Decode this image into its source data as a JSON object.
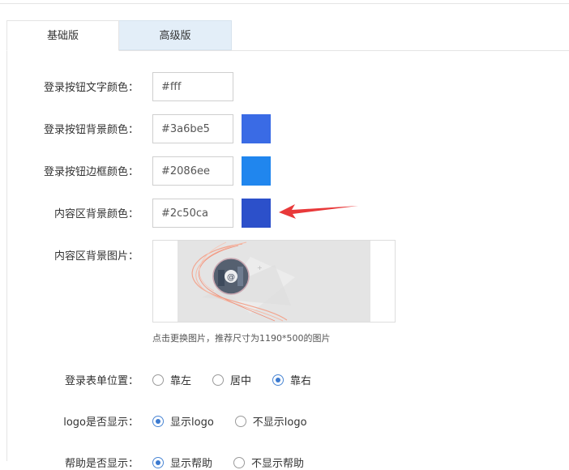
{
  "tabs": [
    {
      "label": "基础版",
      "active": true
    },
    {
      "label": "高级版",
      "active": false
    }
  ],
  "fields": {
    "btn_text_color": {
      "label": "登录按钮文字颜色：",
      "value": "#fff"
    },
    "btn_bg_color": {
      "label": "登录按钮背景颜色：",
      "value": "#3a6be5",
      "swatch": "#3a6be5"
    },
    "btn_border_color": {
      "label": "登录按钮边框颜色：",
      "value": "#2086ee",
      "swatch": "#2086ee"
    },
    "content_bg_color": {
      "label": "内容区背景颜色：",
      "value": "#2c50ca",
      "swatch": "#2c50ca"
    },
    "content_bg_image": {
      "label": "内容区背景图片：",
      "hint": "点击更换图片，推荐尺寸为1190*500的图片"
    }
  },
  "form_position": {
    "label": "登录表单位置：",
    "options": [
      {
        "label": "靠左",
        "checked": false
      },
      {
        "label": "居中",
        "checked": false
      },
      {
        "label": "靠右",
        "checked": true
      }
    ]
  },
  "logo_display": {
    "label": "logo是否显示：",
    "options": [
      {
        "label": "显示logo",
        "checked": true
      },
      {
        "label": "不显示logo",
        "checked": false
      }
    ]
  },
  "help_display": {
    "label": "帮助是否显示：",
    "options": [
      {
        "label": "显示帮助",
        "checked": true
      },
      {
        "label": "不显示帮助",
        "checked": false
      }
    ]
  },
  "colors": {
    "arrow": "#e8393a",
    "tab_inactive_bg": "#e3eef8",
    "radio_checked": "#3b7ad0"
  }
}
